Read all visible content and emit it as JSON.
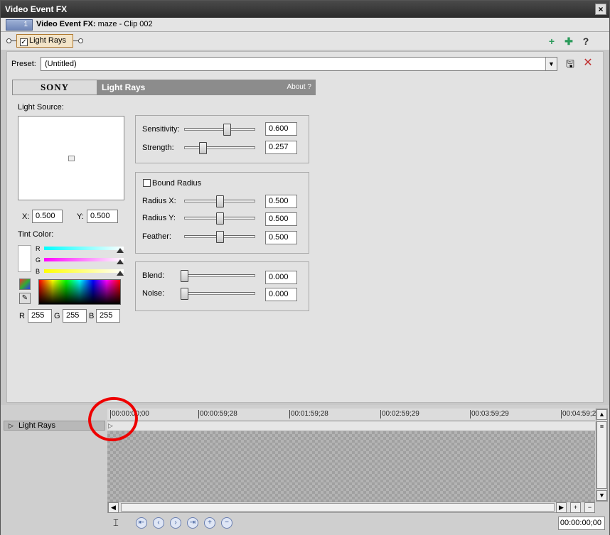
{
  "window": {
    "title": "Video Event FX",
    "close_glyph": "×"
  },
  "header": {
    "track_number": "1",
    "label": "Video Event FX:",
    "clip": "maze - Clip 002"
  },
  "chain": {
    "plugin": "Light Rays",
    "check": "✓",
    "icons": [
      "plug-in-chain-icon",
      "remove-plugin-icon",
      "help-icon"
    ]
  },
  "preset": {
    "label": "Preset:",
    "value": "(Untitled)",
    "drop_glyph": "▼",
    "save_glyph": "🖫",
    "delete_glyph": "✕"
  },
  "plugin_bar": {
    "logo": "SONY",
    "title": "Light Rays",
    "about": "About  ?"
  },
  "light_source": {
    "label": "Light Source:",
    "x_label": "X:",
    "x_value": "0.500",
    "y_label": "Y:",
    "y_value": "0.500"
  },
  "tint": {
    "label": "Tint Color:",
    "r_label": "R",
    "g_label": "G",
    "b_label": "B",
    "r": "255",
    "g": "255",
    "b": "255",
    "bars": [
      {
        "name": "R",
        "color": "#00ffff"
      },
      {
        "name": "G",
        "color": "#ff00ff"
      },
      {
        "name": "B",
        "color": "#ffff00"
      }
    ]
  },
  "sliders1": [
    {
      "label": "Sensitivity:",
      "value": "0.600",
      "level": 0.6
    },
    {
      "label": "Strength:",
      "value": "0.257",
      "level": 0.257
    }
  ],
  "bound_radius": {
    "label": "Bound Radius",
    "checked": false
  },
  "sliders2": [
    {
      "label": "Radius X:",
      "value": "0.500",
      "level": 0.5
    },
    {
      "label": "Radius Y:",
      "value": "0.500",
      "level": 0.5
    },
    {
      "label": "Feather:",
      "value": "0.500",
      "level": 0.5
    }
  ],
  "sliders3": [
    {
      "label": "Blend:",
      "value": "0.000",
      "level": 0.0
    },
    {
      "label": "Noise:",
      "value": "0.000",
      "level": 0.0
    }
  ],
  "timeline": {
    "track_label": "Light Rays",
    "ticks": [
      "00:00:00;00",
      "00:00:59;28",
      "00:01:59;28",
      "00:02:59;29",
      "00:03:59;29",
      "00:04:59;2"
    ],
    "timecode": "00:00:00;00",
    "transport_icons": [
      "go-to-start-icon",
      "prev-keyframe-icon",
      "next-keyframe-icon",
      "go-to-end-icon",
      "add-keyframe-icon",
      "delete-keyframe-icon"
    ]
  },
  "colors": {
    "annotation": "#e00000",
    "track_badge": "#6f86b8"
  }
}
